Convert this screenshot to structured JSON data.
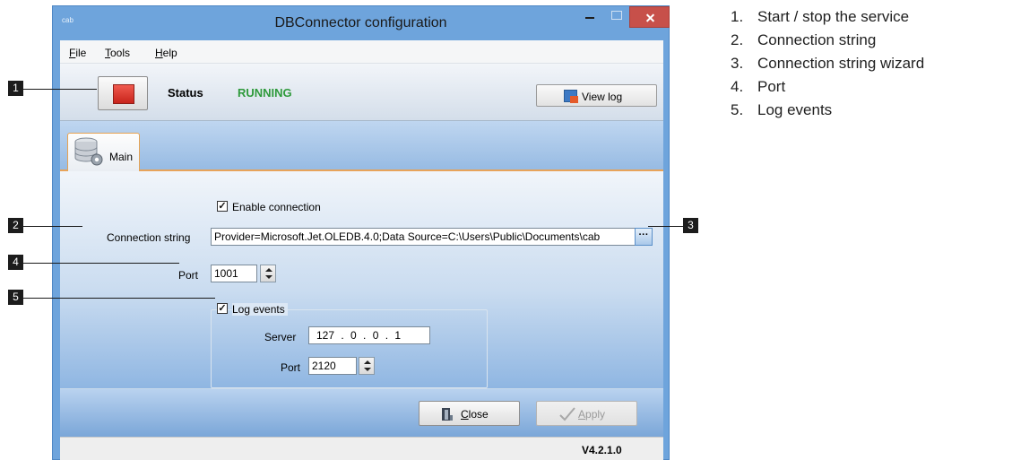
{
  "window": {
    "title": "DBConnector configuration",
    "logo_text": "cab"
  },
  "menu": {
    "items": [
      {
        "mnemonic": "F",
        "rest": "ile"
      },
      {
        "mnemonic": "T",
        "rest": "ools"
      },
      {
        "mnemonic": "H",
        "rest": "elp"
      }
    ]
  },
  "status_panel": {
    "status_label": "Status",
    "status_value": "RUNNING",
    "view_log_label": "View log"
  },
  "tabs": [
    {
      "label": "Main",
      "selected": true
    }
  ],
  "main": {
    "enable_connection_label": "Enable connection",
    "enable_connection_checked": true,
    "connection_string_label": "Connection string",
    "connection_string_value": "Provider=Microsoft.Jet.OLEDB.4.0;Data Source=C:\\Users\\Public\\Documents\\cab",
    "ellipsis_label": "···",
    "port_label": "Port",
    "port_value": "1001",
    "log_events_label": "Log events",
    "log_events_checked": true,
    "server_label": "Server",
    "server_value": "127 . 0 . 0 . 1",
    "log_port_label": "Port",
    "log_port_value": "2120"
  },
  "footer": {
    "close_mnemonic": "C",
    "close_rest": "lose",
    "apply_mnemonic": "A",
    "apply_rest": "pply",
    "apply_enabled": false
  },
  "statusbar": {
    "version": "V4.2.1.0"
  },
  "callouts": [
    "1",
    "2",
    "3",
    "4",
    "5"
  ],
  "legend": [
    {
      "num": "1.",
      "text": "Start / stop the service"
    },
    {
      "num": "2.",
      "text": "Connection string"
    },
    {
      "num": "3.",
      "text": "Connection string wizard"
    },
    {
      "num": "4.",
      "text": "Port"
    },
    {
      "num": "5.",
      "text": "Log events"
    }
  ],
  "colors": {
    "window_frame": "#6ea4dc",
    "close_button": "#c7504a",
    "status_running": "#2f9a3c",
    "stop_button": "#e0362c",
    "tab_accent": "#e7a35a"
  },
  "icons": [
    "close-icon",
    "minimize-icon",
    "maximize-icon",
    "stop-icon",
    "log-icon",
    "database-gear-icon",
    "door-icon",
    "checkmark-icon"
  ]
}
